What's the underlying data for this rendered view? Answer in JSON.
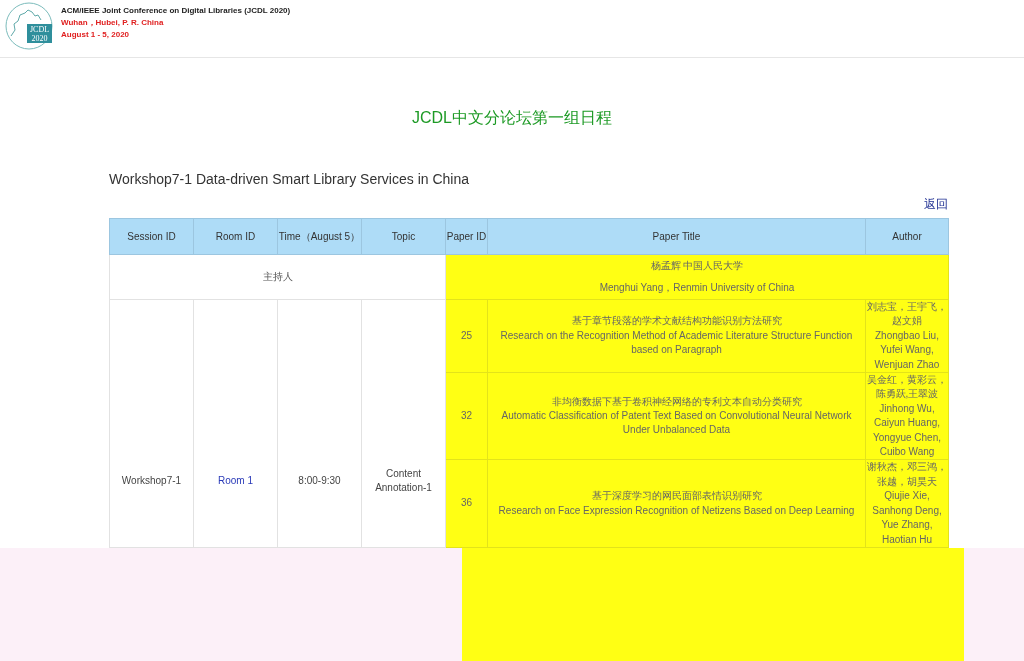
{
  "header": {
    "logo_text": [
      "JCDL",
      "2020"
    ],
    "conference": "ACM/IEEE Joint Conference on Digital Libraries (JCDL 2020)",
    "location": "Wuhan，Hubei, P. R. China",
    "dates": "August 1 - 5, 2020"
  },
  "page_title": "JCDL中文分论坛第一组日程",
  "workshop_title": "Workshop7-1 Data-driven Smart Library Services in China",
  "back_link": "返回",
  "table": {
    "columns": [
      "Session ID",
      "Room ID",
      "Time（August 5）",
      "Topic",
      "Paper ID",
      "Paper Title",
      "Author"
    ],
    "host_row": {
      "label": "主持人",
      "host_zh": "杨孟辉 中国人民大学",
      "host_en": "Menghui Yang，Renmin University of China"
    },
    "session": {
      "session_id": "Workshop7-1",
      "room": "Room 1",
      "time": "8:00-9:30",
      "topic": "Content Annotation-1"
    },
    "papers": [
      {
        "paper_id": "25",
        "title_zh": "基于章节段落的学术文献结构功能识别方法研究",
        "title_en": "Research on the Recognition Method of Academic Literature Structure Function based on Paragraph",
        "authors_zh": "刘志宝，王宇飞，赵文娟",
        "authors_en": "Zhongbao Liu, Yufei Wang, Wenjuan Zhao"
      },
      {
        "paper_id": "32",
        "title_zh": "非均衡数据下基于卷积神经网络的专利文本自动分类研究",
        "title_en": "Automatic Classification of Patent Text Based on Convolutional Neural Network Under Unbalanced Data",
        "authors_zh": "吴金红，黄彩云，陈勇跃,王翠波",
        "authors_en": "Jinhong Wu, Caiyun Huang, Yongyue Chen, Cuibo Wang"
      },
      {
        "paper_id": "36",
        "title_zh": "基于深度学习的网民面部表情识别研究",
        "title_en": "Research on Face Expression Recognition of Netizens Based on Deep Learning",
        "authors_zh": "谢秋杰，邓三鸿，张越，胡昊天",
        "authors_en": "Qiujie Xie, Sanhong Deng, Yue Zhang, Haotian Hu"
      }
    ]
  }
}
